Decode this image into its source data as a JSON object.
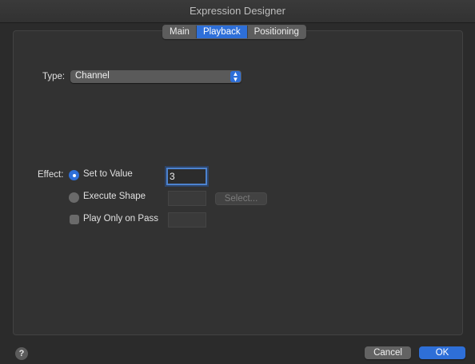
{
  "window": {
    "title": "Expression Designer"
  },
  "tabs": [
    {
      "label": "Main",
      "active": false
    },
    {
      "label": "Playback",
      "active": true
    },
    {
      "label": "Positioning",
      "active": false
    }
  ],
  "type_field": {
    "label": "Type:",
    "value": "Channel"
  },
  "effect": {
    "label": "Effect:",
    "options": [
      {
        "label": "Set to Value",
        "selected": true
      },
      {
        "label": "Execute Shape",
        "selected": false
      }
    ],
    "value_input": "3",
    "select_button": "Select...",
    "play_only_on_pass": {
      "label": "Play Only on Pass",
      "checked": false
    }
  },
  "footer": {
    "help": "?",
    "cancel": "Cancel",
    "ok": "OK"
  },
  "colors": {
    "accent": "#2e6fd8",
    "background": "#2b2b2b",
    "panel": "#323232"
  },
  "icons": {
    "select_arrows": "chevron-up-down-icon",
    "help": "question-mark-icon"
  }
}
